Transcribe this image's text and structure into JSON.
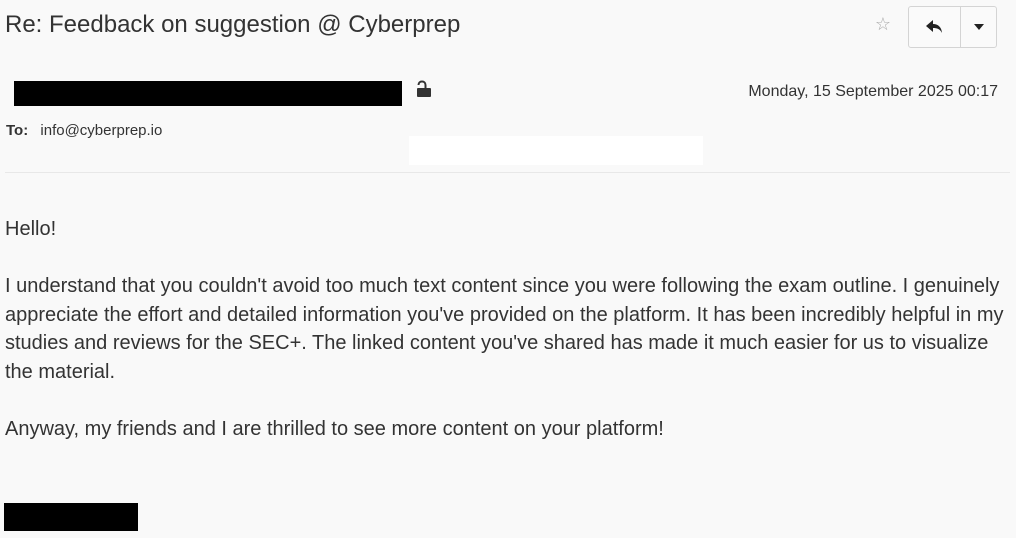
{
  "email": {
    "subject": "Re: Feedback on suggestion @ Cyberprep",
    "date": "Monday, 15 September 2025 00:17",
    "to_label": "To:",
    "to_address": "info@cyberprep.io",
    "body": {
      "greeting": "Hello!",
      "paragraph1": "I understand that you couldn't avoid too much text content since you were following the exam outline. I genuinely appreciate the effort and detailed information you've provided on the platform. It has been incredibly helpful in my studies and reviews for the SEC+. The linked content you've shared has made it much easier for us to visualize the material.",
      "paragraph2": "Anyway, my friends and I are thrilled to see more content on your platform!"
    }
  },
  "icons": {
    "star": "star-outline-icon",
    "reply": "reply-arrow-icon",
    "more": "caret-down-icon",
    "lock": "unlocked-padlock-icon"
  },
  "colors": {
    "background": "#f9f9f9",
    "text": "#333333",
    "redaction": "#000000",
    "star": "#aaaaaa"
  }
}
